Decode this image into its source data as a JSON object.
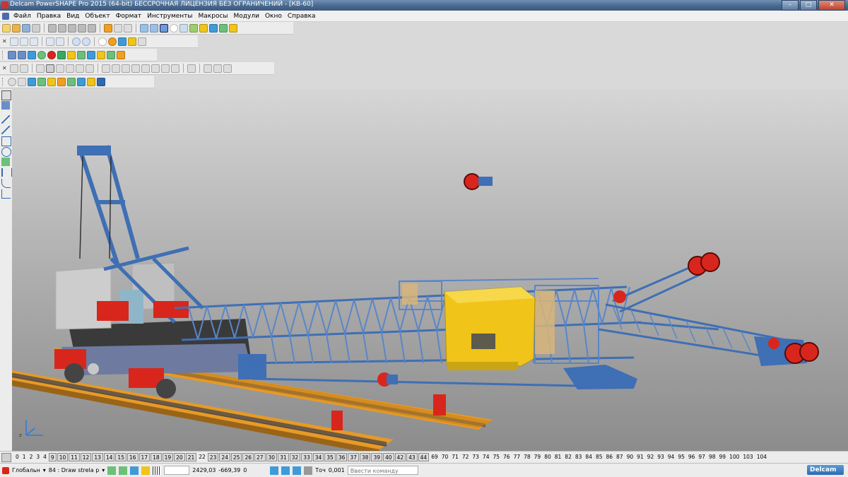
{
  "window": {
    "title": "Delcam PowerSHAPE Pro 2015 (64-bit) БЕССРОЧНАЯ ЛИЦЕНЗИЯ БЕЗ ОГРАНИЧЕНИЙ - [КВ-60]"
  },
  "menu": [
    "Файл",
    "Правка",
    "Вид",
    "Объект",
    "Формат",
    "Инструменты",
    "Макросы",
    "Модули",
    "Окно",
    "Справка"
  ],
  "levels": [
    "0",
    "1",
    "2",
    "3",
    "4",
    "9",
    "10",
    "11",
    "12",
    "13",
    "14",
    "15",
    "16",
    "17",
    "18",
    "19",
    "20",
    "21",
    "22",
    "23",
    "24",
    "25",
    "26",
    "27",
    "30",
    "31",
    "32",
    "33",
    "34",
    "35",
    "36",
    "37",
    "38",
    "39",
    "40",
    "42",
    "43",
    "44",
    "69",
    "70",
    "71",
    "72",
    "73",
    "74",
    "75",
    "76",
    "77",
    "78",
    "79",
    "80",
    "81",
    "82",
    "83",
    "84",
    "85",
    "86",
    "87",
    "90",
    "91",
    "92",
    "93",
    "94",
    "95",
    "96",
    "97",
    "98",
    "99",
    "100",
    "103",
    "104"
  ],
  "status": {
    "workplane": "Глобальн",
    "level": "84 : Draw strela p",
    "x": "2429,03",
    "y": "-669,39",
    "z": "0",
    "tolerance_label": "Точ",
    "tolerance": "0,001",
    "command_placeholder": "Ввести команду"
  },
  "brand": "Delcam",
  "colors": {
    "truss": "#3f6fb4",
    "truss_light": "#6d97d6",
    "cabin": "#f0c419",
    "red_parts": "#d9261c",
    "rail_wood": "#e79a26",
    "rail_steel": "#7a6a55",
    "counterweight": "#c9c9c9"
  }
}
